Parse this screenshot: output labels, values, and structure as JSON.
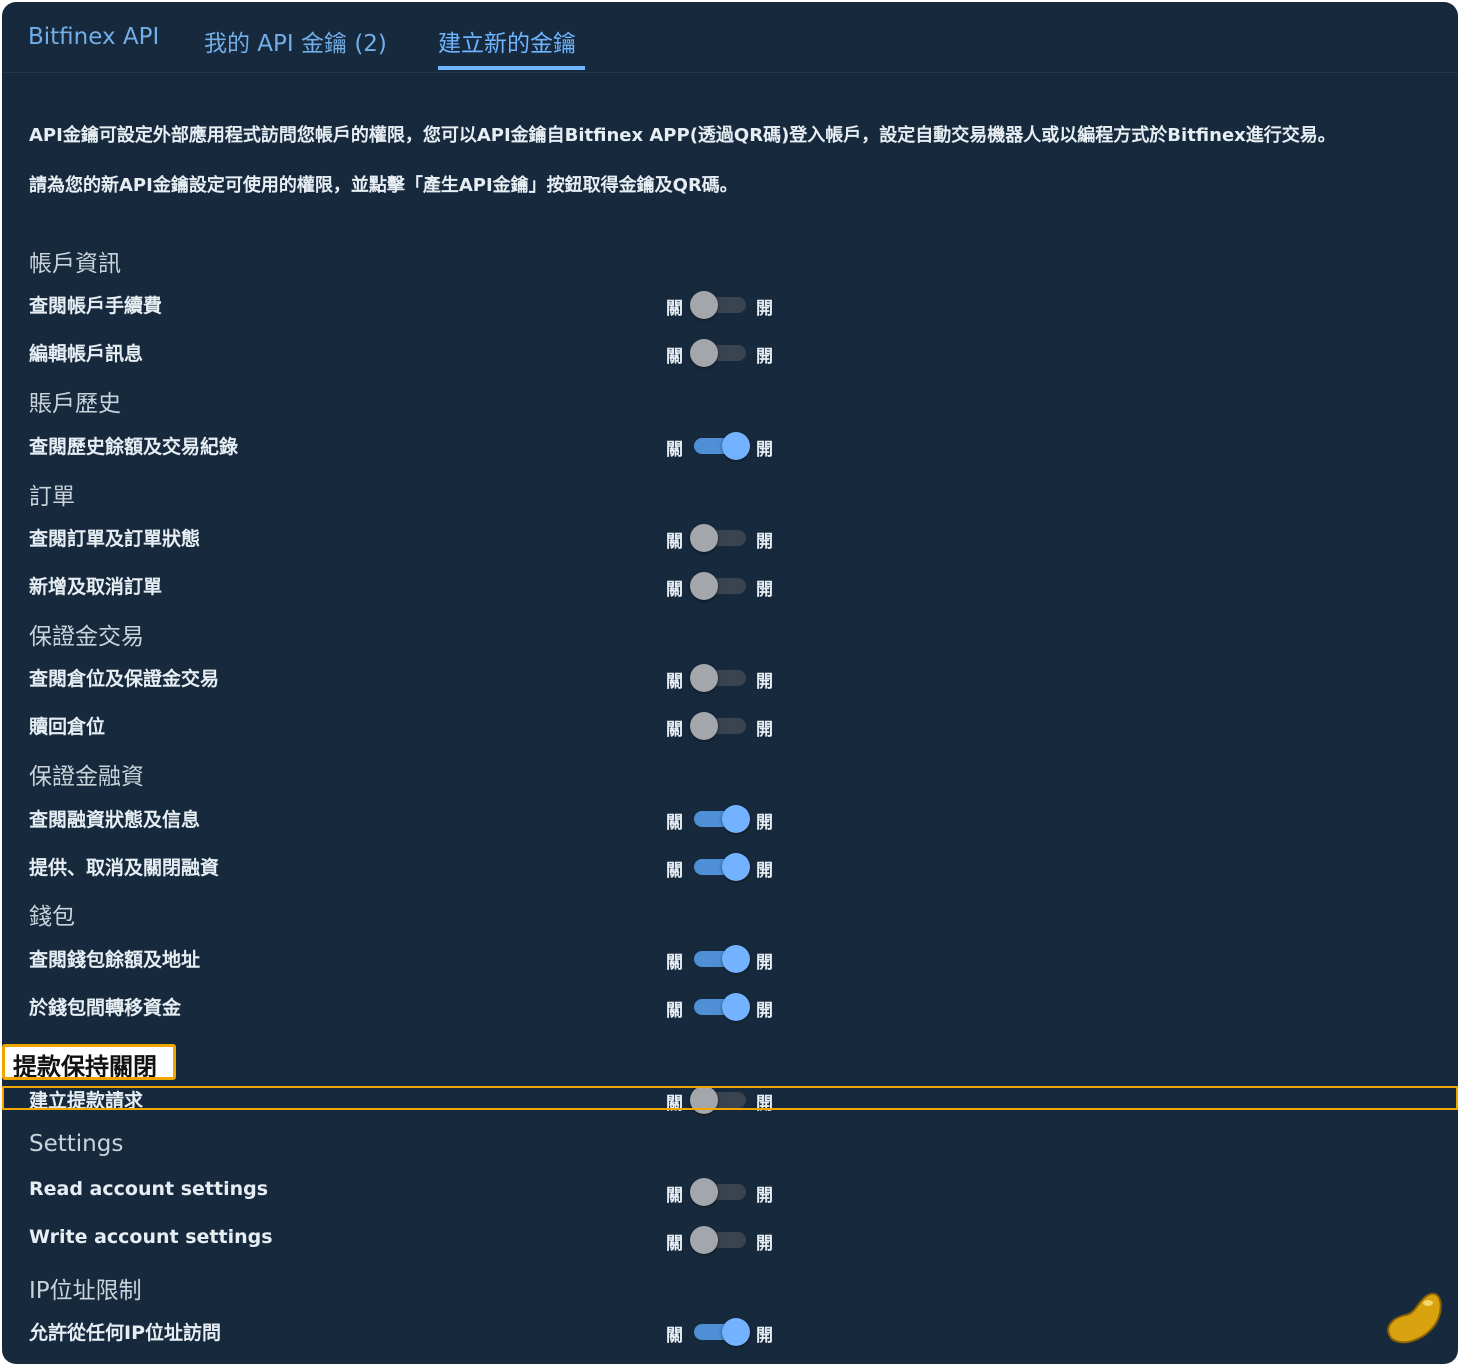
{
  "tabs": [
    {
      "label": "Bitfinex API"
    },
    {
      "label": "我的 API 金鑰 (2)"
    },
    {
      "label": "建立新的金鑰"
    }
  ],
  "intro": [
    "API金鑰可設定外部應用程式訪問您帳戶的權限，您可以API金鑰自Bitfinex APP(透過QR碼)登入帳戶，設定自動交易機器人或以編程方式於Bitfinex進行交易。",
    "請為您的新API金鑰設定可使用的權限，並點擊「產生API金鑰」按鈕取得金鑰及QR碼。"
  ],
  "toggle_labels": {
    "off": "關",
    "on": "開"
  },
  "sections": [
    {
      "title": "帳戶資訊",
      "permissions": [
        {
          "label": "查閱帳戶手續費",
          "enabled": false
        },
        {
          "label": "編輯帳戶訊息",
          "enabled": false
        }
      ]
    },
    {
      "title": "賬戶歷史",
      "permissions": [
        {
          "label": "查閱歷史餘額及交易紀錄",
          "enabled": true
        }
      ]
    },
    {
      "title": "訂單",
      "permissions": [
        {
          "label": "查閱訂單及訂單狀態",
          "enabled": false
        },
        {
          "label": "新增及取消訂單",
          "enabled": false
        }
      ]
    },
    {
      "title": "保證金交易",
      "permissions": [
        {
          "label": "查閱倉位及保證金交易",
          "enabled": false
        },
        {
          "label": "贖回倉位",
          "enabled": false
        }
      ]
    },
    {
      "title": "保證金融資",
      "permissions": [
        {
          "label": "查閱融資狀態及信息",
          "enabled": true
        },
        {
          "label": "提供、取消及關閉融資",
          "enabled": true
        }
      ]
    },
    {
      "title": "錢包",
      "permissions": [
        {
          "label": "查閱錢包餘額及地址",
          "enabled": true
        },
        {
          "label": "於錢包間轉移資金",
          "enabled": true
        }
      ]
    },
    {
      "title": "提款",
      "permissions": [
        {
          "label": "建立提款請求",
          "enabled": false
        }
      ]
    },
    {
      "title": "Settings",
      "permissions": [
        {
          "label": "Read account settings",
          "enabled": false
        },
        {
          "label": "Write account settings",
          "enabled": false
        }
      ]
    },
    {
      "title": "IP位址限制",
      "permissions": [
        {
          "label": "允許從任何IP位址訪問",
          "enabled": true
        }
      ]
    }
  ],
  "annotation": {
    "label": "提款保持關閉"
  },
  "colors": {
    "background": "#172a3d",
    "accent": "#6fb4ff",
    "highlight": "#f0a500"
  },
  "icons": {
    "assistant": "bean-mascot-icon"
  }
}
